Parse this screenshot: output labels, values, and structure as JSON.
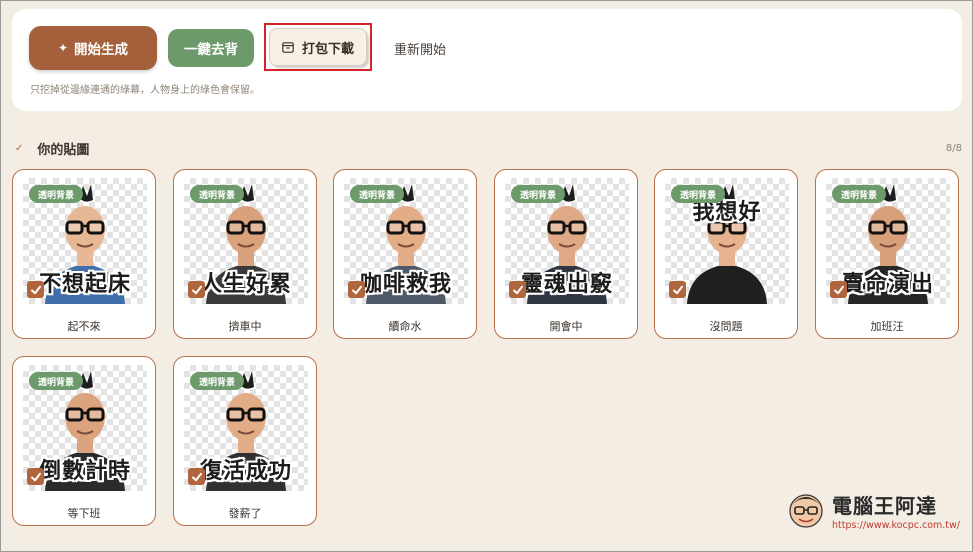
{
  "toolbar": {
    "generate_label": "開始生成",
    "remove_bg_label": "一鍵去背",
    "download_label": "打包下載",
    "restart_label": "重新開始",
    "hint": "只挖掉從邊緣連通的綠幕，人物身上的綠色會保留。"
  },
  "section": {
    "title": "你的貼圖",
    "count": "8/8"
  },
  "badge_label": "透明背景",
  "stickers": [
    {
      "label": "起不來",
      "caption": "不想起床"
    },
    {
      "label": "擠車中",
      "caption": "人生好累"
    },
    {
      "label": "續命水",
      "caption": "咖啡救我"
    },
    {
      "label": "開會中",
      "caption": "靈魂出竅"
    },
    {
      "label": "沒問題",
      "caption": "我想好"
    },
    {
      "label": "加班汪",
      "caption": "賣命演出"
    },
    {
      "label": "等下班",
      "caption": "倒數計時"
    },
    {
      "label": "發薪了",
      "caption": "復活成功"
    }
  ],
  "watermark": {
    "title": "電腦王阿達",
    "url": "https://www.kocpc.com.tw/"
  },
  "colors": {
    "primary": "#a3603a",
    "green": "#6d9a6b",
    "highlight": "#d6222a",
    "background": "#f3ede4"
  }
}
